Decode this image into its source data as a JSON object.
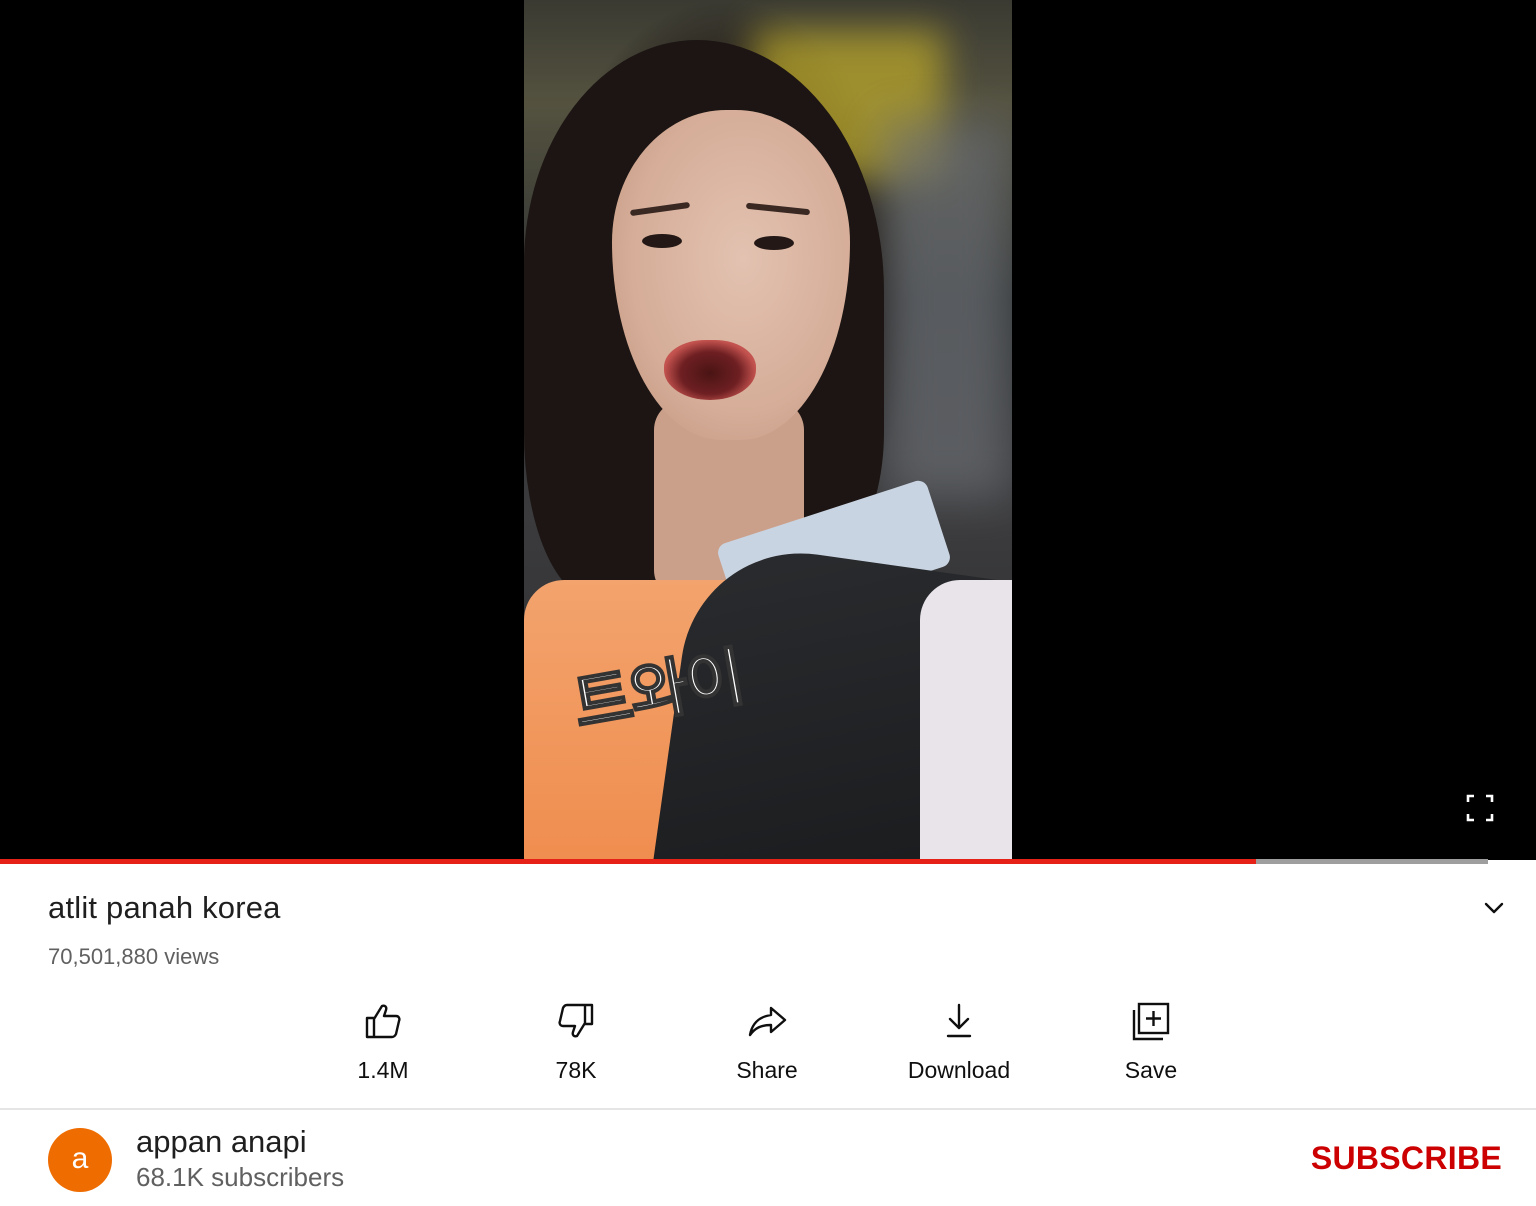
{
  "video": {
    "title": "atlit panah korea",
    "views": "70,501,880 views",
    "progress_played_fraction": 0.818,
    "progress_buffered_fraction": 0.969,
    "overlay_text": "트와이"
  },
  "actions": [
    {
      "icon": "thumb-up-icon",
      "label": "1.4M"
    },
    {
      "icon": "thumb-down-icon",
      "label": "78K"
    },
    {
      "icon": "share-icon",
      "label": "Share"
    },
    {
      "icon": "download-icon",
      "label": "Download"
    },
    {
      "icon": "save-to-playlist-icon",
      "label": "Save"
    }
  ],
  "channel": {
    "avatar_letter": "a",
    "avatar_color": "#ef6c00",
    "name": "appan anapi",
    "subscribers": "68.1K subscribers",
    "subscribe_label": "SUBSCRIBE",
    "subscribe_color": "#cc0000"
  },
  "icons": {
    "fullscreen": "fullscreen-icon",
    "expand": "chevron-down-icon"
  }
}
